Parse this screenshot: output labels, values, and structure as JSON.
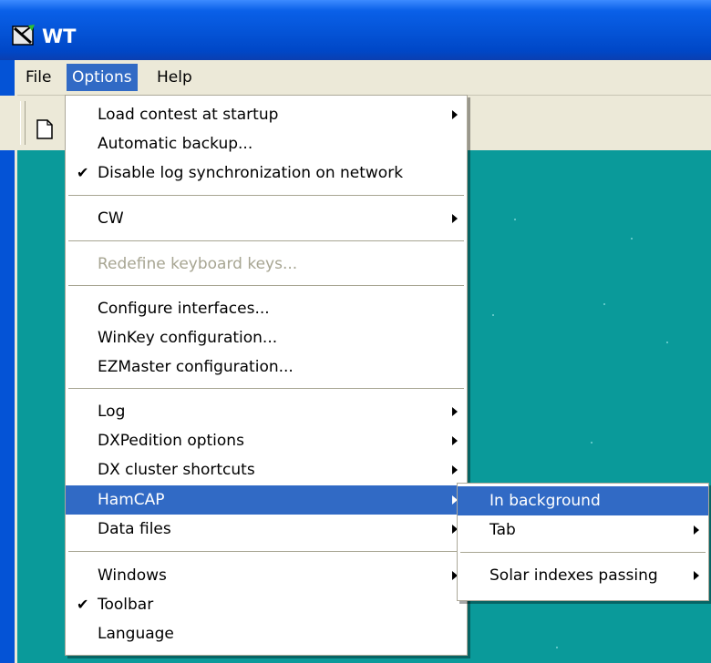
{
  "window": {
    "title": "WT"
  },
  "menubar": {
    "file": "File",
    "options": "Options",
    "help": "Help"
  },
  "options_menu": {
    "load_contest": "Load contest at startup",
    "auto_backup": "Automatic backup...",
    "disable_sync": "Disable log synchronization on network",
    "cw": "CW",
    "redefine_keys": "Redefine keyboard keys...",
    "configure_interfaces": "Configure interfaces...",
    "winkey": "WinKey configuration...",
    "ezmaster": "EZMaster configuration...",
    "log": "Log",
    "dxpedition": "DXPedition options",
    "dx_cluster": "DX cluster shortcuts",
    "hamcap": "HamCAP",
    "data_files": "Data files",
    "windows": "Windows",
    "toolbar": "Toolbar",
    "language": "Language"
  },
  "hamcap_submenu": {
    "in_background": "In background",
    "tab": "Tab",
    "solar": "Solar indexes passing"
  },
  "checkmark": "✔",
  "colors": {
    "titlebar": "#0453d6",
    "client_background": "#0a9a9a",
    "highlight": "#316ac5",
    "menu_bar": "#ece9d8"
  }
}
